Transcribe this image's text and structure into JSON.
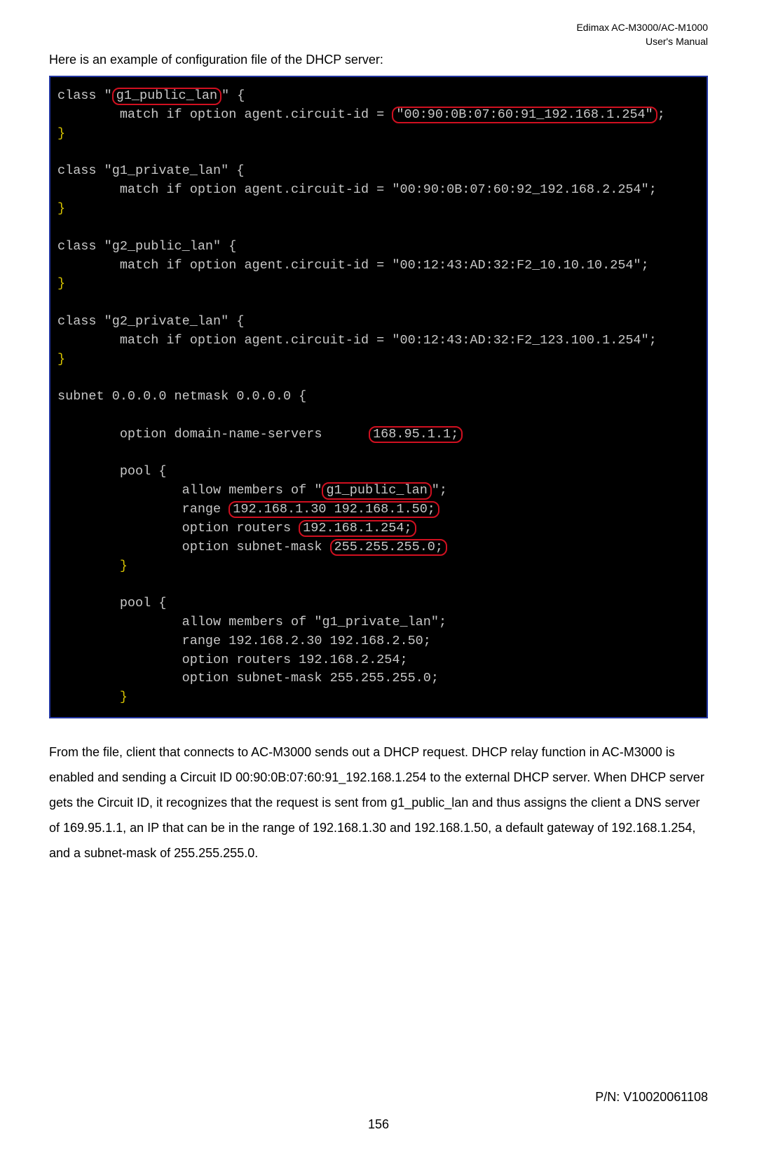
{
  "header": {
    "line1": "Edimax AC-M3000/AC-M1000",
    "line2": "User's Manual"
  },
  "intro": "Here is an example of configuration file of the DHCP server:",
  "code": {
    "c1_open_a": "class \"",
    "c1_name": "g1_public_lan",
    "c1_open_b": "\" {",
    "c1_match_a": "        match if option agent.circuit-id = ",
    "c1_match_b": "\"00:90:0B:07:60:91_192.168.1.254\"",
    "c1_match_c": ";",
    "close": "}",
    "c2_open": "class \"g1_private_lan\" {",
    "c2_match": "        match if option agent.circuit-id = \"00:90:0B:07:60:92_192.168.2.254\";",
    "c3_open": "class \"g2_public_lan\" {",
    "c3_match": "        match if option agent.circuit-id = \"00:12:43:AD:32:F2_10.10.10.254\";",
    "c4_open": "class \"g2_private_lan\" {",
    "c4_match": "        match if option agent.circuit-id = \"00:12:43:AD:32:F2_123.100.1.254\";",
    "subnet": "subnet 0.0.0.0 netmask 0.0.0.0 {",
    "dns_a": "        option domain-name-servers      ",
    "dns_b": "168.95.1.1;",
    "pool1_open": "        pool {",
    "p1_l1a": "                allow members of \"",
    "p1_l1b": "g1_public_lan",
    "p1_l1c": "\";",
    "p1_l2a": "                range ",
    "p1_l2b": "192.168.1.30 192.168.1.50;",
    "p1_l3a": "                option routers ",
    "p1_l3b": "192.168.1.254;",
    "p1_l4a": "                option subnet-mask ",
    "p1_l4b": "255.255.255.0;",
    "pool_close": "        }",
    "pool2_open": "        pool {",
    "p2_l1": "                allow members of \"g1_private_lan\";",
    "p2_l2": "                range 192.168.2.30 192.168.2.50;",
    "p2_l3": "                option routers 192.168.2.254;",
    "p2_l4": "                option subnet-mask 255.255.255.0;"
  },
  "body": "From the file, client that connects to AC-M3000 sends out a DHCP request. DHCP relay function in AC-M3000 is enabled and sending a Circuit ID 00:90:0B:07:60:91_192.168.1.254 to the external DHCP server. When DHCP server gets the Circuit ID, it recognizes that the request is sent from g1_public_lan and thus assigns the client a DNS server of 169.95.1.1, an IP that can be in the range of 192.168.1.30 and 192.168.1.50, a default gateway of 192.168.1.254, and a subnet-mask of 255.255.255.0.",
  "footer": "P/N: V10020061108",
  "pagenum": "156"
}
